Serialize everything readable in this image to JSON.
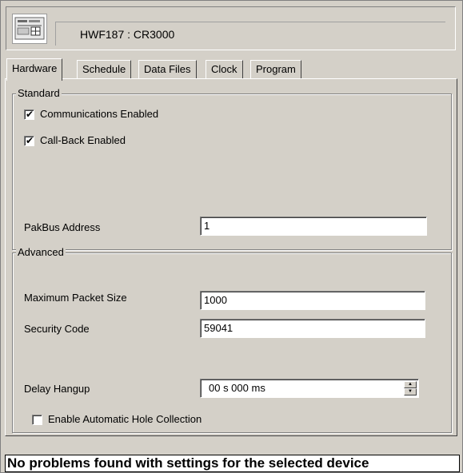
{
  "header": {
    "device_icon": "datalogger-icon",
    "device_title": "HWF187 : CR3000"
  },
  "tabs": [
    {
      "label": "Hardware",
      "active": true
    },
    {
      "label": "Schedule",
      "active": false
    },
    {
      "label": "Data Files",
      "active": false
    },
    {
      "label": "Clock",
      "active": false
    },
    {
      "label": "Program",
      "active": false
    }
  ],
  "standard": {
    "group_label": "Standard",
    "communications_enabled": {
      "label": "Communications Enabled",
      "checked": true
    },
    "callback_enabled": {
      "label": "Call-Back Enabled",
      "checked": true
    },
    "pakbus_address": {
      "label": "PakBus Address",
      "value": "1"
    }
  },
  "advanced": {
    "group_label": "Advanced",
    "max_packet_size": {
      "label": "Maximum Packet Size",
      "value": "1000"
    },
    "security_code": {
      "label": "Security Code",
      "value": "59041"
    },
    "delay_hangup": {
      "label": "Delay Hangup",
      "value": "00 s 000 ms"
    },
    "auto_hole_collection": {
      "label": "Enable Automatic Hole Collection",
      "checked": false
    }
  },
  "status": {
    "message": "No problems found with settings for the selected device"
  },
  "check_glyph": "✔"
}
